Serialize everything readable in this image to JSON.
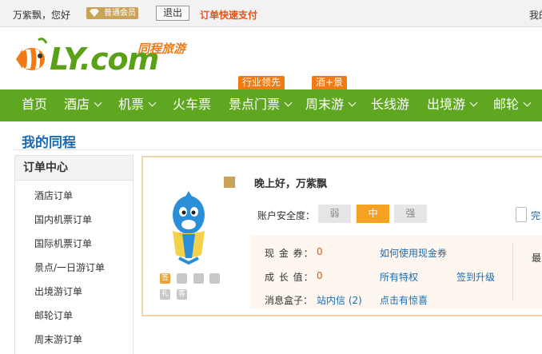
{
  "topbar": {
    "greeting": "万紫飘，您好",
    "member_badge": "普通会员",
    "logout_label": "退出",
    "quick_pay": "订单快速支付",
    "right_text": "我的"
  },
  "logo": {
    "latin": "LY.com",
    "chinese": "同程旅游"
  },
  "nav": {
    "items": [
      {
        "label": "首页",
        "caret": false
      },
      {
        "label": "酒店",
        "caret": true
      },
      {
        "label": "机票",
        "caret": true
      },
      {
        "label": "火车票",
        "caret": false
      },
      {
        "label": "景点门票",
        "caret": true
      },
      {
        "label": "周末游",
        "caret": true
      },
      {
        "label": "长线游",
        "caret": false
      },
      {
        "label": "出境游",
        "caret": true
      },
      {
        "label": "邮轮",
        "caret": true
      }
    ],
    "badges": [
      "行业领先",
      "酒+景"
    ]
  },
  "page_title": "我的同程",
  "sidebar": {
    "heading": "订单中心",
    "items": [
      "酒店订单",
      "国内机票订单",
      "国际机票订单",
      "景点/一日游订单",
      "出境游订单",
      "邮轮订单",
      "周末游订单"
    ]
  },
  "account": {
    "hello": "晚上好，万紫飘",
    "security_label": "账户安全度：",
    "security_levels": [
      "弱",
      "中",
      "强"
    ],
    "security_current": "中",
    "right_link": "完",
    "service_icons": [
      "签",
      "礼",
      "客"
    ],
    "info": {
      "cash_label": "现 金 券：",
      "cash_value": "0",
      "cash_link": "如何使用现金券",
      "growth_label": "成 长 值：",
      "growth_value": "0",
      "privilege_link": "所有特权",
      "upgrade_link": "签到升级",
      "msg_label": "消息盒子：",
      "msg_link": "站内信 (2)",
      "surprise_link": "点击有惊喜",
      "right_text": "最"
    }
  },
  "colors": {
    "nav_green": "#5fa720",
    "accent_orange": "#f07a14",
    "link_blue": "#1a6bb6",
    "security_active": "#f6a124"
  }
}
